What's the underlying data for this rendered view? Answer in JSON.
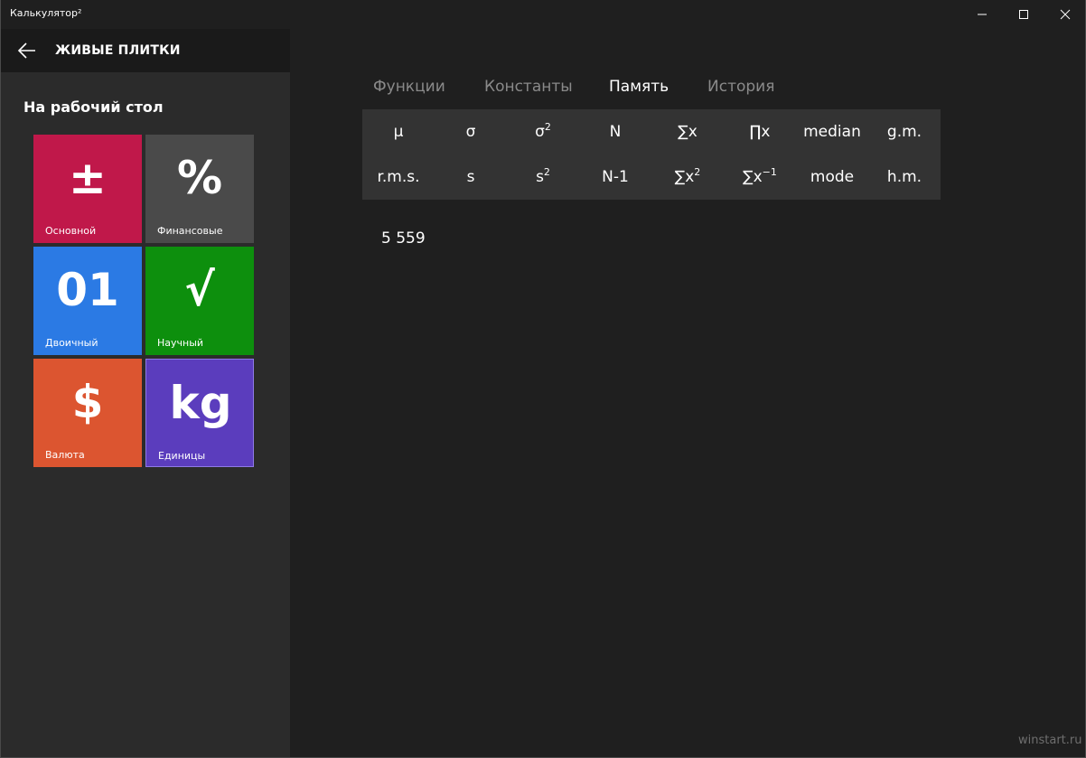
{
  "window": {
    "title": "Калькулятор²",
    "controls": [
      "minimize-icon",
      "maximize-icon",
      "close-icon"
    ]
  },
  "sidebar": {
    "title": "ЖИВЫЕ ПЛИТКИ",
    "section_title": "На рабочий стол",
    "tiles": [
      {
        "glyph": "±",
        "label": "Основной",
        "color": "#c0184a"
      },
      {
        "glyph": "%",
        "label": "Финансовые",
        "color": "#4a4a4a"
      },
      {
        "glyph": "01",
        "label": "Двоичный",
        "color": "#2b7ae4"
      },
      {
        "glyph": "√",
        "label": "Научный",
        "color": "#0d8f0d"
      },
      {
        "glyph": "$",
        "label": "Валюта",
        "color": "#dc5530"
      },
      {
        "glyph": "kg",
        "label": "Единицы",
        "color": "#5b3dbd"
      }
    ]
  },
  "tabs": [
    {
      "label": "Функции",
      "active": false
    },
    {
      "label": "Константы",
      "active": false
    },
    {
      "label": "Память",
      "active": true
    },
    {
      "label": "История",
      "active": false
    }
  ],
  "functions": {
    "row1": [
      {
        "base": "μ",
        "sup": ""
      },
      {
        "base": "σ",
        "sup": ""
      },
      {
        "base": "σ",
        "sup": "2"
      },
      {
        "base": "N",
        "sup": ""
      },
      {
        "base": "∑x",
        "sup": ""
      },
      {
        "base": "∏x",
        "sup": ""
      },
      {
        "base": "median",
        "sup": ""
      },
      {
        "base": "g.m.",
        "sup": ""
      }
    ],
    "row2": [
      {
        "base": "r.m.s.",
        "sup": ""
      },
      {
        "base": "s",
        "sup": ""
      },
      {
        "base": "s",
        "sup": "2"
      },
      {
        "base": "N-1",
        "sup": ""
      },
      {
        "base": "∑x",
        "sup": "2"
      },
      {
        "base": "∑x",
        "sup": "−1"
      },
      {
        "base": "mode",
        "sup": ""
      },
      {
        "base": "h.m.",
        "sup": ""
      }
    ]
  },
  "memory": {
    "value": "5 559"
  },
  "watermark": "winstart.ru",
  "colors": {
    "background": "#1f1f1f",
    "sidebar": "#2b2b2b",
    "panel": "#333333",
    "tab_inactive": "#8a8a8a"
  }
}
